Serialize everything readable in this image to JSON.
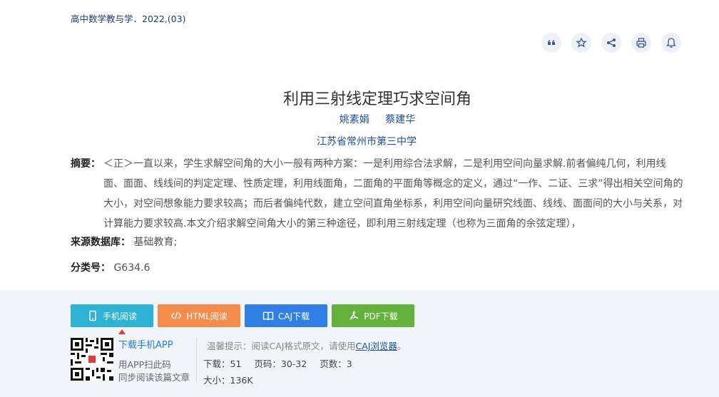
{
  "journal": "高中数学教与学．2022,(03)",
  "toolbar": [
    {
      "icon": "quote-icon",
      "name": "cite-button"
    },
    {
      "icon": "star-icon",
      "name": "favorite-button"
    },
    {
      "icon": "share-icon",
      "name": "share-button"
    },
    {
      "icon": "print-icon",
      "name": "print-button"
    },
    {
      "icon": "bell-icon",
      "name": "notify-button"
    }
  ],
  "title": "利用三射线定理巧求空间角",
  "authors": [
    "姚素娟",
    "蔡建华"
  ],
  "organization": "江苏省常州市第三中学",
  "abstract": {
    "label": "摘要：",
    "text": "＜正＞一直以来，学生求解空间角的大小一般有两种方案：一是利用综合法求解，二是利用空间向量求解.前者偏纯几何，利用线面、面面、线线间的判定定理、性质定理，利用线面角，二面角的平面角等概念的定义，通过“一作、二证、三求”得出相关空间角的大小，对空间想象能力要求较高；而后者偏纯代数，建立空间直角坐标系，利用空间向量研究线面、线线、面面间的大小与关系，对计算能力要求较高.本文介绍求解空间角大小的第三种途径，即利用三射线定理（也称为三面角的余弦定理），"
  },
  "source": {
    "label": "来源数据库：",
    "value": "基础教育;"
  },
  "classification": {
    "label": "分类号：",
    "value": "G634.6"
  },
  "buttons": {
    "mobile": "手机阅读",
    "html": "HTML阅读",
    "caj": "CAJ下载",
    "pdf": "PDF下载"
  },
  "app": {
    "download": "下载手机APP",
    "scan_line1": "用APP扫此码",
    "scan_line2": "同步阅读该篇文章"
  },
  "tip": {
    "prefix": "温馨提示：阅读CAJ格式原文，请使用",
    "link": "CAJ浏览器",
    "suffix": "。"
  },
  "stats": {
    "downloads": "下载：51",
    "pages": "页码：30-32",
    "page_count": "页数：3",
    "size": "大小：136K"
  },
  "colors": {
    "accent": "#1f4f9a",
    "caj_blue": "#2f7fe5",
    "pdf_green": "#62b23b",
    "mobile_cyan": "#2eb3d6",
    "html_orange": "#f58c4c"
  }
}
